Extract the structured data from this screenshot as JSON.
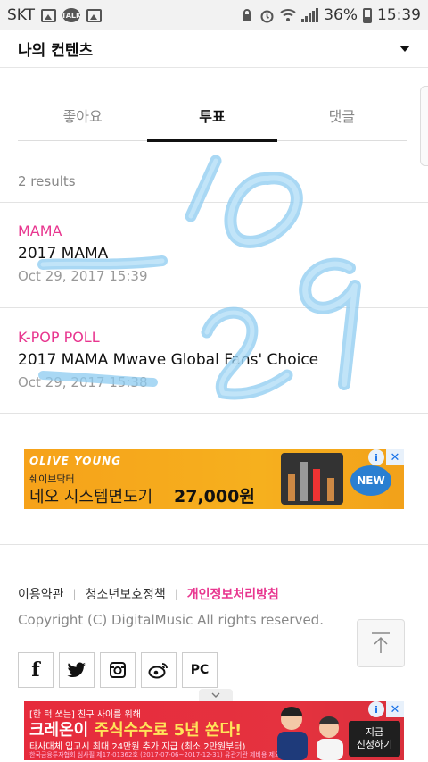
{
  "status_bar": {
    "carrier": "SKT",
    "talk_badge": "TALK",
    "battery": "36%",
    "time": "15:39"
  },
  "header": {
    "title": "나의 컨텐츠"
  },
  "tabs": [
    {
      "label": "좋아요",
      "active": false
    },
    {
      "label": "투표",
      "active": true
    },
    {
      "label": "댓글",
      "active": false
    }
  ],
  "results_count": "2 results",
  "items": [
    {
      "category": "MAMA",
      "name": "2017 MAMA",
      "date": "Oct 29, 2017 15:39"
    },
    {
      "category": "K-POP POLL",
      "name": "2017 MAMA Mwave Global Fans' Choice",
      "date": "Oct 29, 2017 15:38"
    }
  ],
  "ad1": {
    "brand": "OLIVE YOUNG",
    "subtitle": "쉐이브닥터",
    "headline": "네오 시스템면도기",
    "price": "27,000원",
    "badge": "NEW",
    "info": "i",
    "close": "✕"
  },
  "footer": {
    "links": [
      "이용약관",
      "청소년보호정책",
      "개인정보처리방침"
    ],
    "separator": "|",
    "copyright": "Copyright (C) DigitalMusic All rights reserved."
  },
  "social": {
    "facebook": "f",
    "pc": "PC"
  },
  "ad2": {
    "line1": "[한 턱 쏘는] 친구 사이를 위해",
    "line2_a": "크레온이 ",
    "line2_b": "주식수수료 5년 쏜다!",
    "line3": "타사대체 입고시 최대 24만원 추가 지급 (최소 2만원부터)",
    "line4": "한국금융투자협회 심사필 제17-01362호 (2017-07-06~2017-12-31) 유관기관 제비용 제외",
    "cta": "지금\n신청하기",
    "info": "i",
    "close": "✕"
  },
  "colors": {
    "accent_pink": "#e8368f",
    "active_tab": "#111111",
    "muted_text": "#888888"
  },
  "annotation": {
    "handwritten_text": "10-29"
  }
}
